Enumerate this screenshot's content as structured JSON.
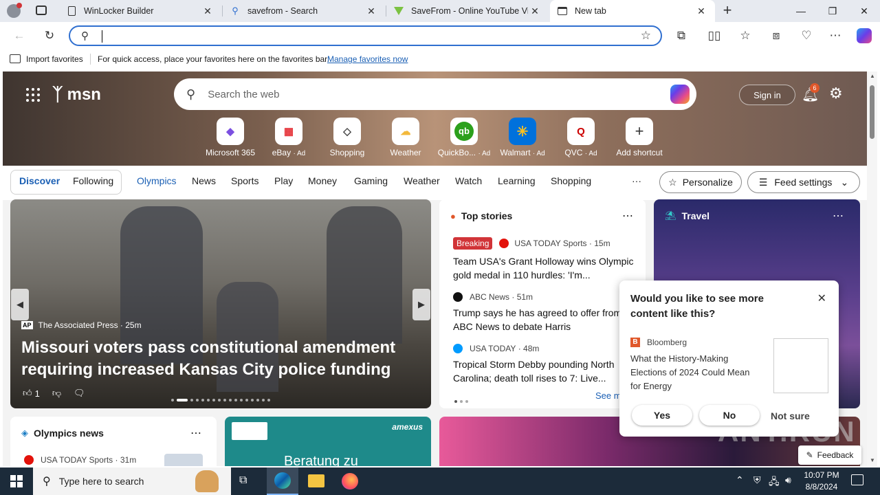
{
  "tabs": [
    {
      "label": "WinLocker Builder"
    },
    {
      "label": "savefrom - Search"
    },
    {
      "label": "SaveFrom - Online YouTube Vide"
    },
    {
      "label": "New tab"
    }
  ],
  "address_bar": {
    "value": "",
    "placeholder": ""
  },
  "favorites_bar": {
    "import_label": "Import favorites",
    "message": "For quick access, place your favorites here on the favorites bar.",
    "manage_link": "Manage favorites now"
  },
  "msn": {
    "logo": "msn",
    "search_placeholder": "Search the web",
    "sign_in": "Sign in",
    "notification_count": "6",
    "quick_links": [
      {
        "label": "Microsoft 365",
        "ad": ""
      },
      {
        "label": "eBay",
        "ad": "· Ad"
      },
      {
        "label": "Shopping",
        "ad": ""
      },
      {
        "label": "Weather",
        "ad": ""
      },
      {
        "label": "QuickBo...",
        "ad": "· Ad"
      },
      {
        "label": "Walmart",
        "ad": "· Ad"
      },
      {
        "label": "QVC",
        "ad": "· Ad"
      },
      {
        "label": "Add shortcut",
        "ad": ""
      }
    ],
    "nav": {
      "discover": "Discover",
      "following": "Following",
      "items": [
        "Olympics",
        "News",
        "Sports",
        "Play",
        "Money",
        "Gaming",
        "Weather",
        "Watch",
        "Learning",
        "Shopping"
      ],
      "more": "···",
      "personalize": "Personalize",
      "feed_settings": "Feed settings"
    },
    "hero_story": {
      "source": "The Associated Press",
      "time": "· 25m",
      "title": "Missouri voters pass constitutional amendment requiring increased Kansas City police funding",
      "likes": "1"
    },
    "top_stories": {
      "title": "Top stories",
      "items": [
        {
          "badge": "Breaking",
          "source": "USA TODAY Sports",
          "time": "· 15m",
          "headline": "Team USA's Grant Holloway wins Olympic gold medal in 110 hurdles: 'I'm..."
        },
        {
          "badge": "",
          "source": "ABC News",
          "time": "· 51m",
          "headline": "Trump says he has agreed to offer from ABC News to debate Harris"
        },
        {
          "badge": "",
          "source": "USA TODAY",
          "time": "· 48m",
          "headline": "Tropical Storm Debby pounding North Carolina; death toll rises to 7: Live..."
        }
      ],
      "see_more": "See m"
    },
    "travel": {
      "title": "Travel"
    },
    "olympics_news": {
      "title": "Olympics news",
      "source": "USA TODAY Sports",
      "time": "· 31m"
    },
    "ad_card": {
      "brand": "amexus",
      "text": "Beratung zu"
    },
    "feedback": "Feedback"
  },
  "popup": {
    "question": "Would you like to see more content like this?",
    "source": "Bloomberg",
    "headline": "What the History-Making Elections of 2024 Could Mean for Energy",
    "yes": "Yes",
    "no": "No",
    "not_sure": "Not sure"
  },
  "taskbar": {
    "search_placeholder": "Type here to search",
    "time": "10:07 PM",
    "date": "8/8/2024"
  },
  "watermark": "ANY.RUN"
}
